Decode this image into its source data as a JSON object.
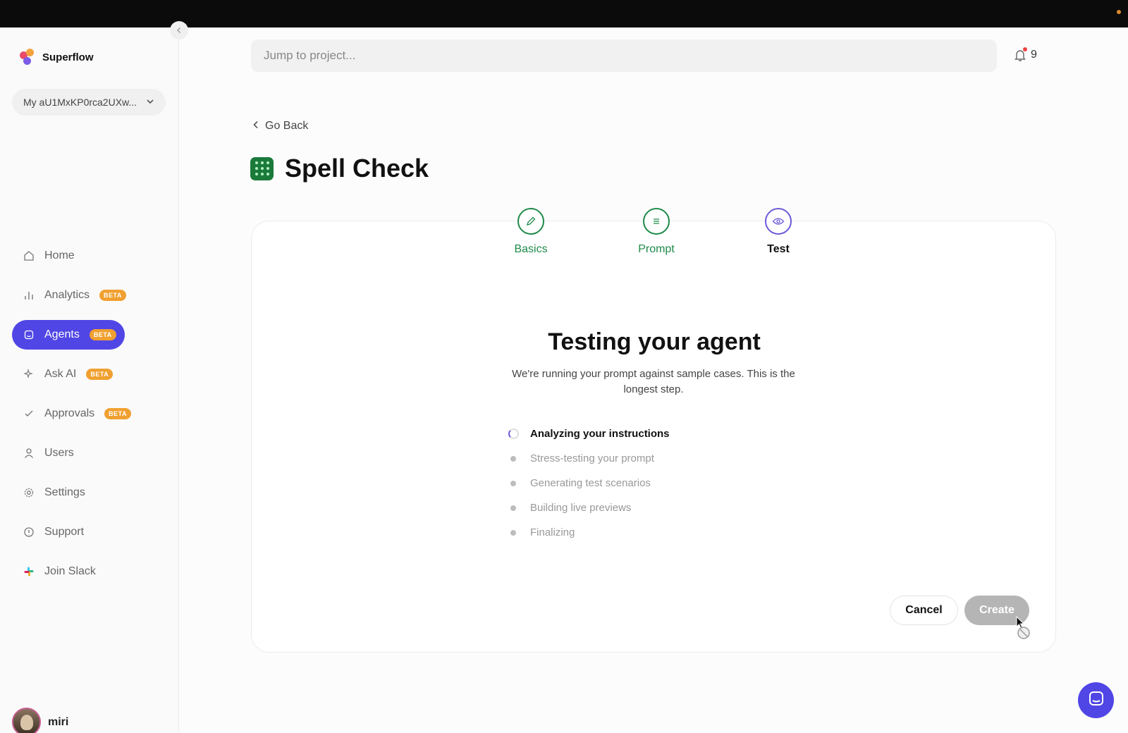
{
  "app": {
    "name": "Superflow",
    "workspace": "My aU1MxKP0rca2UXw..."
  },
  "search": {
    "placeholder": "Jump to project..."
  },
  "notifications": {
    "count": "9"
  },
  "sidebar": {
    "items": [
      {
        "label": "Home",
        "icon": "home-icon"
      },
      {
        "label": "Analytics",
        "badge": "BETA",
        "icon": "bar-chart-icon"
      },
      {
        "label": "Agents",
        "badge": "BETA",
        "icon": "bot-icon",
        "active": true
      },
      {
        "label": "Ask AI",
        "badge": "BETA",
        "icon": "sparkle-icon"
      },
      {
        "label": "Approvals",
        "badge": "BETA",
        "icon": "check-icon"
      },
      {
        "label": "Users",
        "icon": "user-icon"
      },
      {
        "label": "Settings",
        "icon": "gear-icon"
      },
      {
        "label": "Support",
        "icon": "info-icon"
      },
      {
        "label": "Join Slack",
        "icon": "slack-icon"
      }
    ],
    "user": {
      "name": "miri"
    }
  },
  "page": {
    "back_label": "Go Back",
    "title": "Spell Check"
  },
  "steps": [
    {
      "label": "Basics",
      "state": "done"
    },
    {
      "label": "Prompt",
      "state": "done"
    },
    {
      "label": "Test",
      "state": "current"
    }
  ],
  "testing": {
    "title": "Testing your agent",
    "subtitle": "We're running your prompt against sample cases. This is the longest step.",
    "checklist": [
      {
        "label": "Analyzing your instructions",
        "state": "in-progress"
      },
      {
        "label": "Stress-testing your prompt",
        "state": "pending"
      },
      {
        "label": "Generating test scenarios",
        "state": "pending"
      },
      {
        "label": "Building live previews",
        "state": "pending"
      },
      {
        "label": "Finalizing",
        "state": "pending"
      }
    ]
  },
  "actions": {
    "cancel_label": "Cancel",
    "create_label": "Create"
  },
  "colors": {
    "accent": "#5046e5",
    "step_done": "#1e8a4a",
    "badge": "#f0a030"
  }
}
